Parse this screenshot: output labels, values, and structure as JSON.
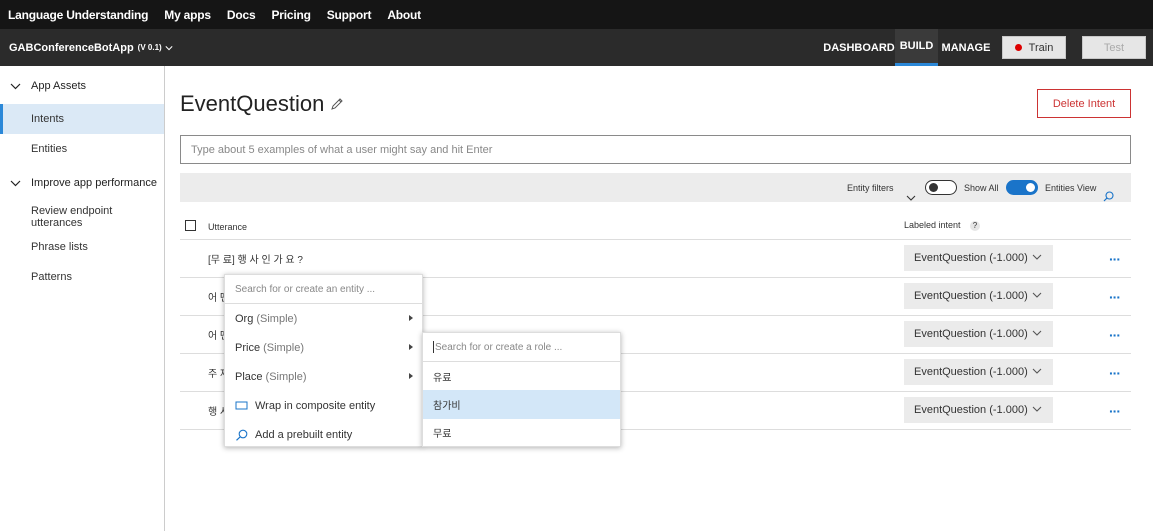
{
  "topnav": {
    "brand": "Language Understanding",
    "items": [
      "My apps",
      "Docs",
      "Pricing",
      "Support",
      "About"
    ]
  },
  "appbar": {
    "app_name": "GABConferenceBotApp",
    "version": "(V 0.1)",
    "tabs": [
      "DASHBOARD",
      "BUILD",
      "MANAGE"
    ],
    "active_tab": "BUILD",
    "train_label": "Train",
    "test_label": "Test"
  },
  "sidebar": {
    "group1": "App Assets",
    "group1_items": [
      "Intents",
      "Entities"
    ],
    "group2": "Improve app performance",
    "group2_items": [
      "Review endpoint utterances",
      "Phrase lists",
      "Patterns"
    ],
    "active_item": "Intents"
  },
  "main": {
    "title": "EventQuestion",
    "delete_label": "Delete Intent",
    "utterance_placeholder": "Type about 5 examples of what a user might say and hit Enter",
    "filter": {
      "entity_filters": "Entity filters",
      "show_all": "Show All",
      "entities_view": "Entities View",
      "show_all_on": false,
      "entities_view_on": true
    },
    "table": {
      "col_utterance": "Utterance",
      "col_intent": "Labeled intent",
      "help": "?",
      "rows": [
        {
          "utterance": "[무 료] 행 사 인 가 요 ?",
          "intent": "EventQuestion (-1.000)"
        },
        {
          "utterance": "어 떤",
          "intent": "EventQuestion (-1.000)"
        },
        {
          "utterance": "어 떤",
          "intent": "EventQuestion (-1.000)"
        },
        {
          "utterance": "주 제",
          "intent": "EventQuestion (-1.000)"
        },
        {
          "utterance": "행 사",
          "intent": "EventQuestion (-1.000)"
        }
      ]
    }
  },
  "entity_menu": {
    "search_placeholder": "Search for or create an entity ...",
    "items": [
      {
        "name": "Org",
        "kind": "(Simple)"
      },
      {
        "name": "Price",
        "kind": "(Simple)"
      },
      {
        "name": "Place",
        "kind": "(Simple)"
      }
    ],
    "wrap_label": "Wrap in composite entity",
    "prebuilt_label": "Add a prebuilt entity"
  },
  "role_menu": {
    "search_placeholder": "Search for or create a role ...",
    "items": [
      "유료",
      "참가비",
      "무료"
    ],
    "highlighted": "참가비"
  },
  "colors": {
    "accent": "#2b88d8",
    "danger": "#cc3333",
    "topbar": "#151515"
  }
}
